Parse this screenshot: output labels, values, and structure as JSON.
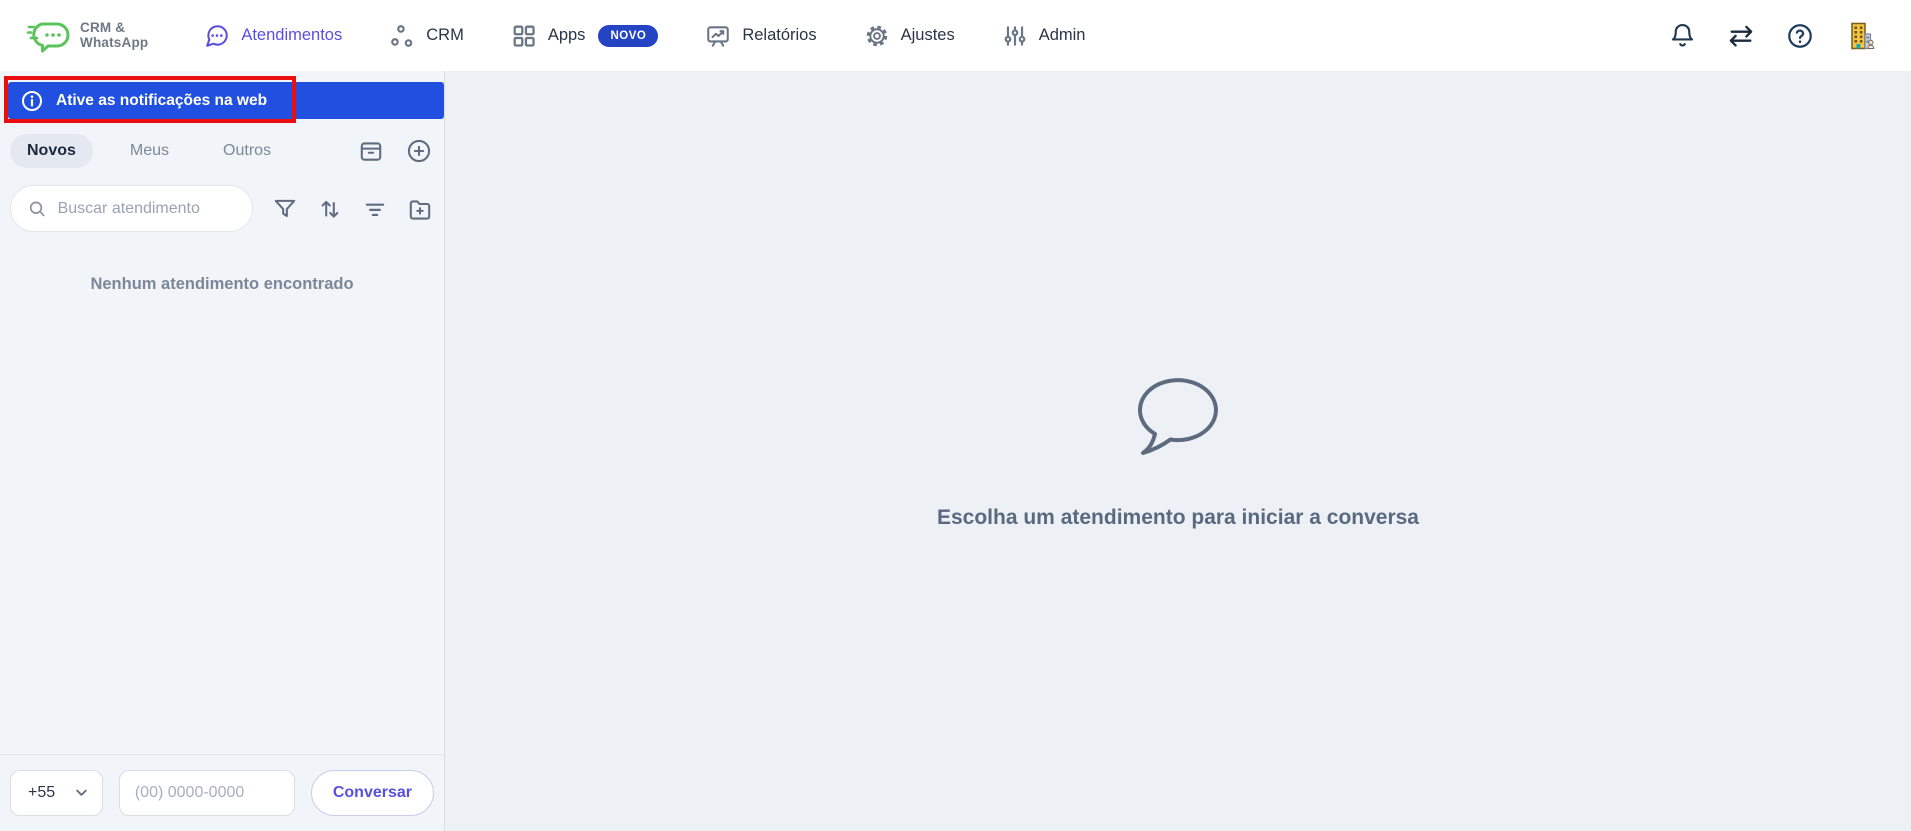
{
  "header": {
    "logo": {
      "line1": "CRM &",
      "line2": "WhatsApp",
      "icon": "green-chat-bubble-logo"
    },
    "nav": [
      {
        "label": "Atendimentos",
        "icon": "chat-bubble-dots",
        "active": true
      },
      {
        "label": "CRM",
        "icon": "nodes"
      },
      {
        "label": "Apps",
        "icon": "grid-squares",
        "badge": "NOVO"
      },
      {
        "label": "Relatórios",
        "icon": "chart-board"
      },
      {
        "label": "Ajustes",
        "icon": "gear"
      },
      {
        "label": "Admin",
        "icon": "sliders"
      }
    ],
    "actions": [
      {
        "icon": "bell"
      },
      {
        "icon": "swap-arrows"
      },
      {
        "icon": "help-circle"
      },
      {
        "icon": "organization-building-avatar"
      }
    ]
  },
  "sidebar": {
    "banner": {
      "text": "Ative as notificações na web",
      "icon": "info-circle"
    },
    "annotation": {
      "shape": "red-highlight-rectangle",
      "color": "#EB0E0E"
    },
    "tabs": [
      {
        "label": "Novos",
        "active": true
      },
      {
        "label": "Meus"
      },
      {
        "label": "Outros"
      }
    ],
    "list_actions": [
      {
        "icon": "archive-box"
      },
      {
        "icon": "plus-circle"
      }
    ],
    "search": {
      "placeholder": "Buscar atendimento",
      "icon": "magnifier"
    },
    "search_actions": [
      {
        "icon": "filter-funnel"
      },
      {
        "icon": "sort-arrows"
      },
      {
        "icon": "filter-lines"
      },
      {
        "icon": "folder-plus"
      }
    ],
    "empty_text": "Nenhum atendimento encontrado",
    "dialer": {
      "country_code": "+55",
      "phone_placeholder": "(00) 0000-0000",
      "button_label": "Conversar"
    }
  },
  "main": {
    "empty_state": "Escolha um atendimento para iniciar a conversa",
    "icon": "speech-bubble-outline"
  },
  "colors": {
    "accent_purple": "#584FE0",
    "banner_blue": "#2150E0",
    "badge_blue": "#2444C4",
    "annotation_red": "#EB0E0E",
    "logo_green": "#5BC35B",
    "background": "#EDF1F6"
  }
}
